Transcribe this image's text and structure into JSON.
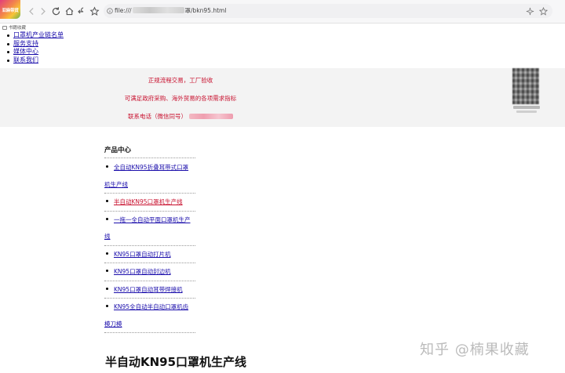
{
  "browser": {
    "tab_logo_text": "亚麻带货",
    "address_prefix": "file:///",
    "address_suffix": "罩/bkn95.html",
    "bookmark_label": "书籍收藏"
  },
  "topnav": {
    "items": [
      "口罩机产业链名单",
      "服务支持",
      "媒体中心",
      "联系我们"
    ]
  },
  "banner": {
    "line1": "正规流程交易，工厂验收",
    "line2": "可满足政府采购、海外贸易的各项需求指标",
    "line3_label": "联系电话（微信同号）"
  },
  "products": {
    "heading": "产品中心",
    "items": [
      {
        "line1": "全自动KN95折叠耳带式口罩",
        "line2": "机生产线"
      },
      {
        "line1": "半自动KN95口罩机生产线",
        "line2": ""
      },
      {
        "line1": "一拖一全自动平面口罩机生产",
        "line2": "线"
      },
      {
        "line1": "KN95口罩自动打片机",
        "line2": ""
      },
      {
        "line1": "KN95口罩自动封边机",
        "line2": ""
      },
      {
        "line1": "KN95口罩自动耳带焊接机",
        "line2": ""
      },
      {
        "line1": "KN95全自动半自动口罩机齿",
        "line2": "模刀模"
      }
    ]
  },
  "page_title": "半自动KN95口罩机生产线",
  "watermark": "知乎 @楠果收藏",
  "colors": {
    "accent_red": "#c8102e",
    "link_blue": "#1a0dab",
    "banner_bg": "#f3f3f3"
  }
}
